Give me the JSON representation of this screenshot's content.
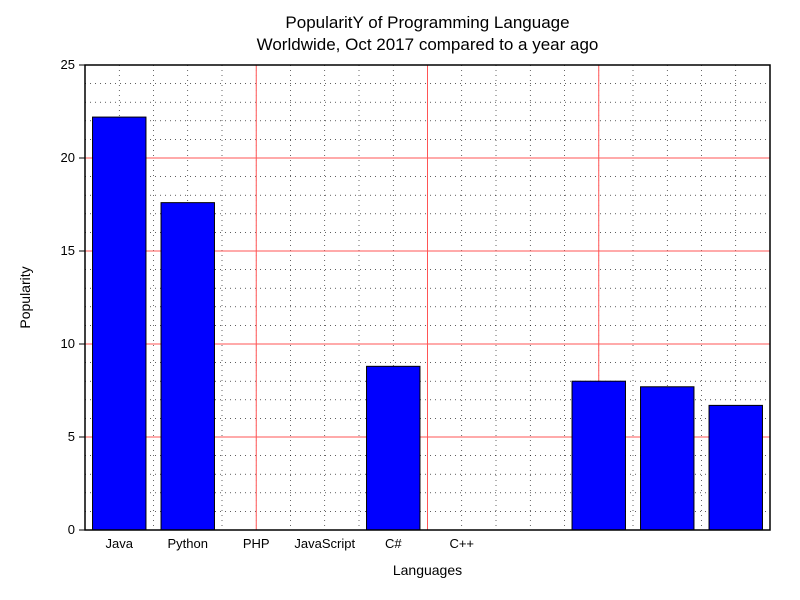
{
  "chart_data": {
    "type": "bar",
    "title_line1": "PopularitY of Programming Language",
    "title_line2": "Worldwide, Oct 2017 compared to a year ago",
    "xlabel": "Languages",
    "ylabel": "Popularity",
    "ylim": [
      0,
      25
    ],
    "yticks": [
      0,
      5,
      10,
      15,
      20,
      25
    ],
    "categories": [
      "Java",
      "Python",
      "PHP",
      "JavaScript",
      "C#",
      "C++",
      "",
      "",
      "",
      ""
    ],
    "values": [
      22.2,
      17.6,
      0,
      0,
      8.8,
      0,
      0,
      8.0,
      7.7,
      6.7
    ],
    "bar_color": "#0000ff",
    "grid_color": "#ff5555"
  }
}
